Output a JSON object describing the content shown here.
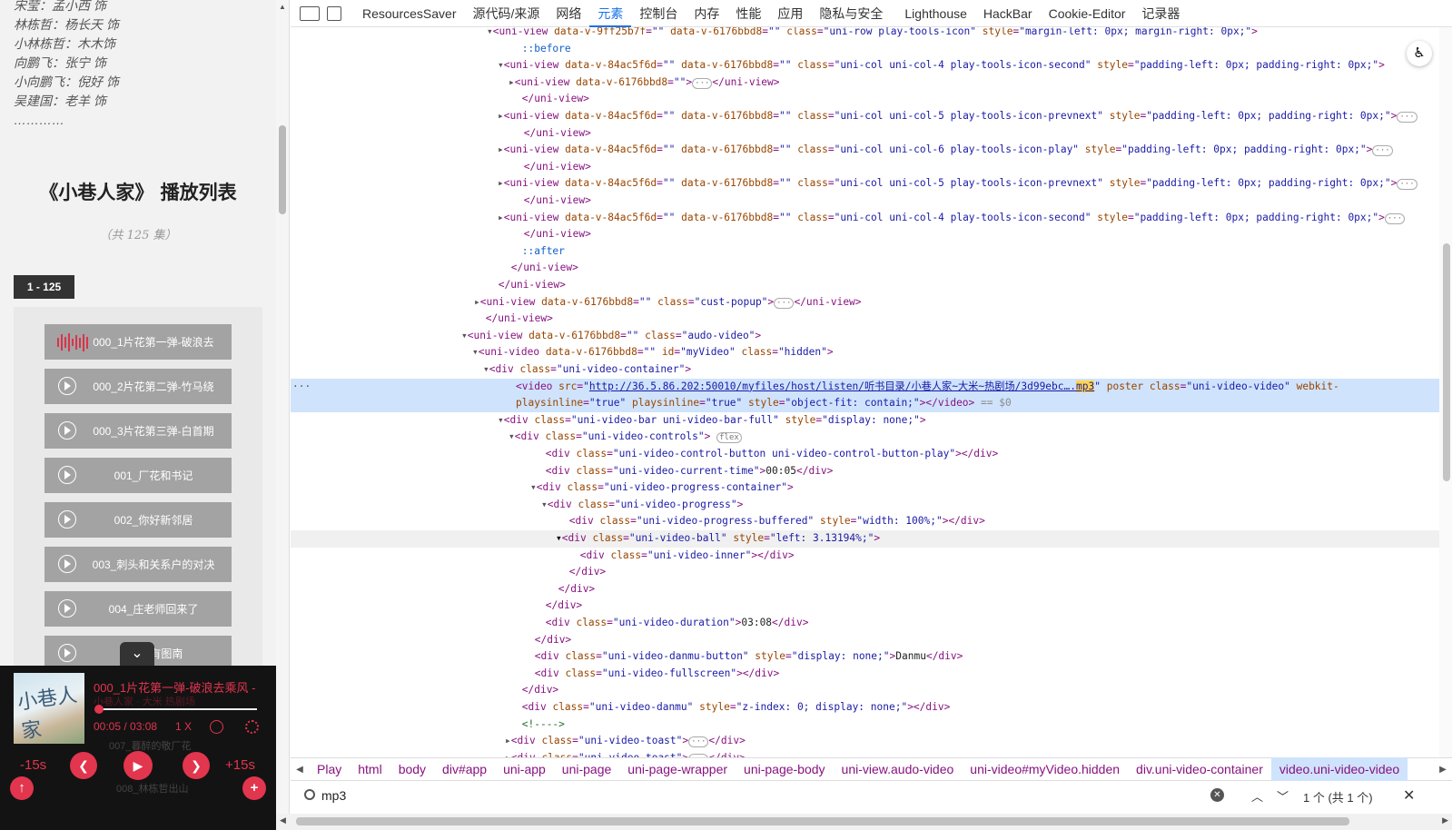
{
  "app": {
    "cast": [
      "宋莹：孟小西 饰",
      "林栋哲：杨长天 饰",
      "小林栋哲：木木饰",
      "向鹏飞：张宁 饰",
      "小向鹏飞：倪好 饰",
      "吴建国：老羊 饰",
      "…………"
    ],
    "playlist_title": "《小巷人家》 播放列表",
    "playlist_count": "（共 125 集）",
    "range_tab": "1 - 125",
    "episodes": [
      "000_1片花第一弹-破浪去",
      "000_2片花第二弹-竹马绕",
      "000_3片花第三弹-白首期",
      "001_厂花和书记",
      "002_你好新邻居",
      "003_刺头和关系户的对决",
      "004_庄老师回来了",
      "00 没有图南"
    ],
    "collapse_icon": "chevron-down",
    "player": {
      "cover_text": "小巷人家",
      "title": "000_1片花第一弹-破浪去乘风 -",
      "subtitle": "小巷人家 · 大米 热剧场",
      "time": "00:05 / 03:08",
      "speed": "1 X",
      "progress": 0.027,
      "back_label": "-15s",
      "fwd_label": "+15s",
      "ghost1": "007_暮醉的敬厂花",
      "ghost2": "008_林栋哲出山",
      "accent": "#e2354e"
    }
  },
  "devtools": {
    "toolbar_icons": [
      "inspect-icon",
      "device-icon"
    ],
    "tabs": [
      "ResourcesSaver",
      "源代码/来源",
      "网络",
      "元素",
      "控制台",
      "内存",
      "性能",
      "应用",
      "隐私与安全",
      "Lighthouse",
      "HackBar",
      "Cookie-Editor",
      "记录器"
    ],
    "active_tab": "元素",
    "breadcrumbs": [
      "Play",
      "html",
      "body",
      "div#app",
      "uni-app",
      "uni-page",
      "uni-page-wrapper",
      "uni-page-body",
      "uni-view.audo-video",
      "uni-video#myVideo.hidden",
      "div.uni-video-container",
      "video.uni-video-video"
    ],
    "search": {
      "value": "mp3",
      "result": "1 个 (共 1 个)"
    },
    "selected_suffix": "== $0"
  }
}
